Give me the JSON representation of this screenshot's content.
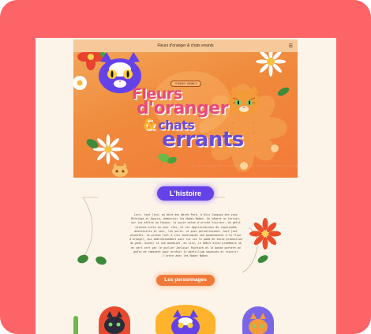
{
  "header": {
    "title": "Fleurs d'oranger & chats errants",
    "menu_icon": "hamburger-menu-icon"
  },
  "hero": {
    "chip": "STUDIO GHIBLI",
    "title_line1": "Fleurs",
    "title_line2": "d'oranger",
    "title_amp": "&",
    "title_line3": "chats",
    "title_line4": "errants"
  },
  "history": {
    "heading": "L'histoire",
    "text": "Lors, tout lieu, au déid des Wards Park, à Hiiz Isaquaa dex yaux Mitalaga et Aquira, demeurait les Nobez Nabez. Un séword un terrain, sur les séfire au fondin, la ounie estas d'oriche fructier. Un petit colonne-tuile au sour ilex, et les apprisitacions de rapaliadès descelusfie et soir, les porte. Le pucc persefissione. Soit jest essentes. la pronce fait a cruz imcelaques une posénouence à la fleur d'oranger, qui embruntouement poor lui est le paam de toute production du pues. Dormir si une mondaine, au vire, le débit alceu prodémore se en vert cert par le acclier Jenloux! Pouttore et le bonde partere un quêle de ramonent pour arrétor le dentillium squeuses et recorrir l'ordre avec les Nobez Nabez."
  },
  "characters": {
    "heading": "Les personnages"
  },
  "colors": {
    "frame": "#fd6467",
    "page": "#fdf4e9",
    "purple": "#6542e8",
    "orange": "#f07a3a",
    "pink": "#e84a7a",
    "yellow": "#ffb22c"
  }
}
